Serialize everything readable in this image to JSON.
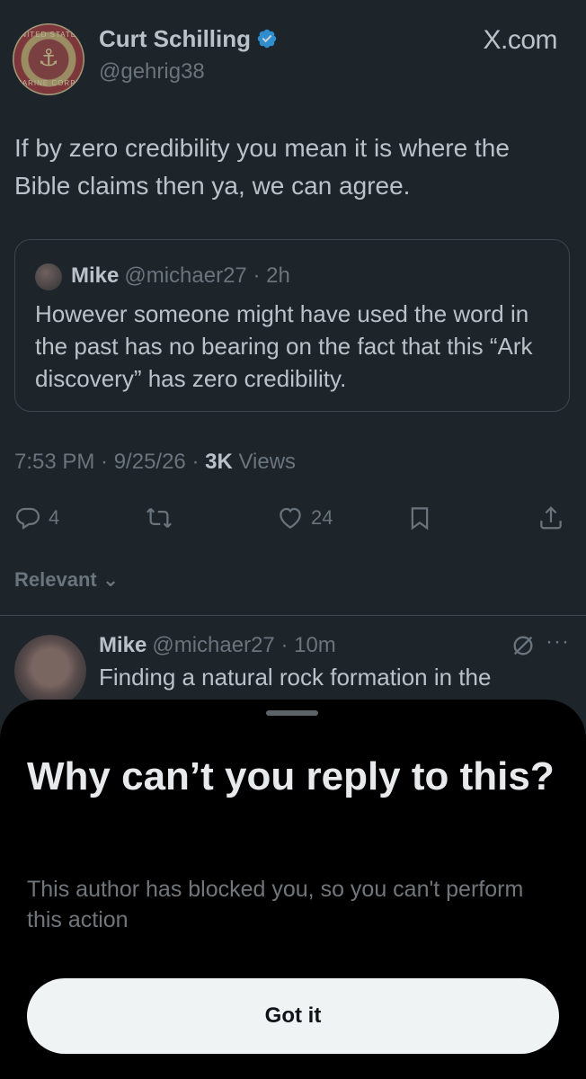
{
  "tweet": {
    "author_name": "Curt Schilling",
    "author_handle": "@gehrig38",
    "avatar_ring_top": "UNITED STATES",
    "avatar_ring_bottom": "MARINE CORPS",
    "site": "X.com",
    "text": "If by zero credibility you mean it is where the Bible claims then ya, we can agree.",
    "quote": {
      "name": "Mike",
      "handle_time": "@michaer27 · 2h",
      "text": "However someone might have used the word in the past has no bearing on the fact that this “Ark discovery” has zero credibility."
    },
    "meta": {
      "time_date": "7:53 PM · 9/25/26 · ",
      "views_count": "3K",
      "views_label": " Views"
    },
    "actions": {
      "reply_count": "4",
      "like_count": "24"
    }
  },
  "replies_sort": "Relevant ⌄",
  "reply": {
    "name": "Mike",
    "handle_time": "@michaer27 · 10m",
    "text": "Finding a natural rock formation in the",
    "more": "···"
  },
  "sheet": {
    "title": "Why can’t you reply to this?",
    "body": "This author has blocked you, so you can't perform this action",
    "button": "Got it"
  },
  "colors": {
    "background": "#000000",
    "text_primary": "#e7e9ea",
    "text_secondary": "#71767b",
    "verified": "#1d9bf0",
    "button_bg": "#eff3f4"
  },
  "icons": [
    "verified-badge-icon",
    "reply-icon",
    "repost-icon",
    "like-icon",
    "bookmark-icon",
    "share-icon",
    "grok-icon",
    "more-icon"
  ]
}
